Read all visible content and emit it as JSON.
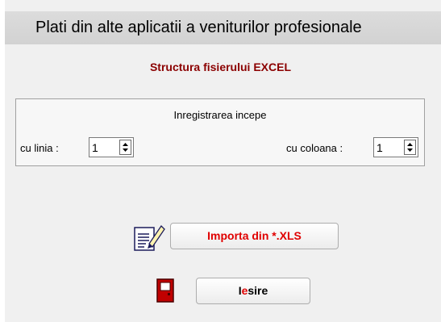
{
  "title": "Plati din alte aplicatii a veniturilor profesionale",
  "subtitle": "Structura fisierului EXCEL",
  "group": {
    "label": "Inregistrarea incepe",
    "row_label": "cu linia :",
    "row_value": "1",
    "col_label": "cu coloana :",
    "col_value": "1"
  },
  "buttons": {
    "import_label": "Importa din *.XLS",
    "exit_label_first": "I",
    "exit_label_accent": "e",
    "exit_label_rest": "sire"
  },
  "icons": {
    "import": "notepad-pencil-icon",
    "exit": "exit-door-icon"
  },
  "colors": {
    "subtitle": "#8b0000",
    "import_text": "#e00000",
    "exit_accent": "#e00000"
  }
}
